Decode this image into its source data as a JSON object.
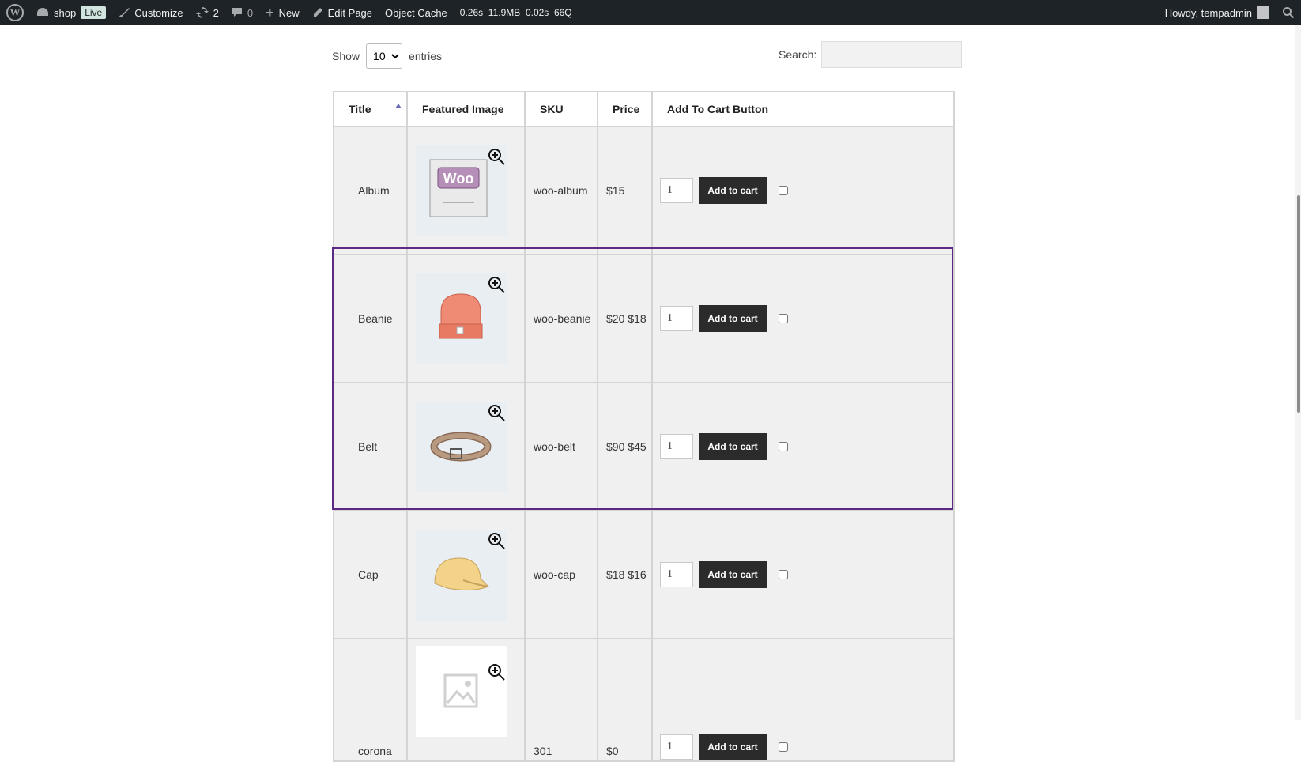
{
  "adminbar": {
    "site": "shop",
    "live": "Live",
    "customize": "Customize",
    "updates_count": "2",
    "comments_count": "0",
    "new": "New",
    "edit_page": "Edit Page",
    "object_cache": "Object Cache",
    "stats": "0.26s  11.9MB  0.02s  66Q",
    "howdy": "Howdy, tempadmin"
  },
  "controls": {
    "show_label": "Show",
    "entries_label": "entries",
    "length_value": "10",
    "search_label": "Search:"
  },
  "columns": [
    "Title",
    "Featured Image",
    "SKU",
    "Price",
    "Add To Cart Button"
  ],
  "rows": [
    {
      "title": "Album",
      "sku": "woo-album",
      "old_price": "",
      "price": "$15",
      "qty": "1",
      "button": "Add to cart",
      "image": "album"
    },
    {
      "title": "Beanie",
      "sku": "woo-beanie",
      "old_price": "$20",
      "price": "$18",
      "qty": "1",
      "button": "Add to cart",
      "image": "beanie"
    },
    {
      "title": "Belt",
      "sku": "woo-belt",
      "old_price": "$90",
      "price": "$45",
      "qty": "1",
      "button": "Add to cart",
      "image": "belt"
    },
    {
      "title": "Cap",
      "sku": "woo-cap",
      "old_price": "$18",
      "price": "$16",
      "qty": "1",
      "button": "Add to cart",
      "image": "cap"
    },
    {
      "title": "corona",
      "sku": "301",
      "old_price": "",
      "price": "$0",
      "qty": "1",
      "button": "Add to cart",
      "image": "placeholder"
    }
  ],
  "colors": {
    "adminbar_bg": "#1d2327",
    "button_bg": "#2b2b2b",
    "highlight": "#5b2a86"
  }
}
